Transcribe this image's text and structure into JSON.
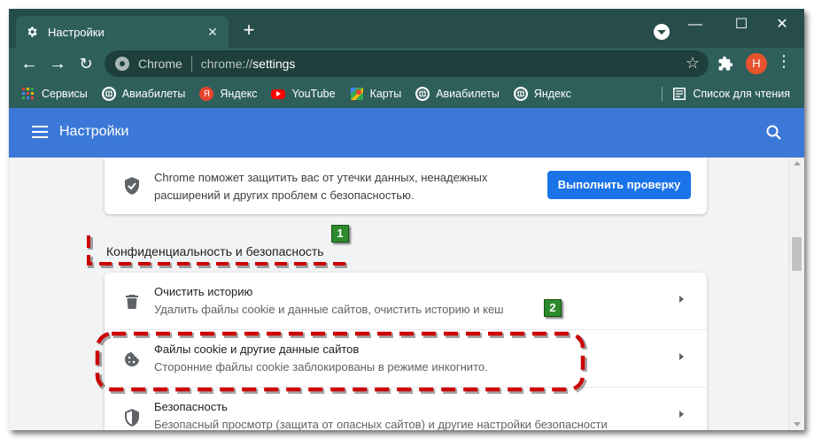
{
  "tab": {
    "title": "Настройки",
    "close": "✕",
    "new": "+"
  },
  "window_controls": {
    "minimize": "—",
    "maximize": "☐",
    "close": "✕"
  },
  "omnibox": {
    "site": "Chrome",
    "url_prefix": "chrome://",
    "url_path": "settings"
  },
  "profile": {
    "initial": "Н",
    "color": "#e8532d"
  },
  "bookmarks": {
    "items": [
      {
        "label": "Сервисы",
        "icon": "apps-grid-icon"
      },
      {
        "label": "Авиабилеты",
        "icon": "globe-icon"
      },
      {
        "label": "Яндекс",
        "icon": "yandex-icon"
      },
      {
        "label": "YouTube",
        "icon": "youtube-icon"
      },
      {
        "label": "Карты",
        "icon": "maps-icon"
      },
      {
        "label": "Авиабилеты",
        "icon": "globe-icon"
      },
      {
        "label": "Яндекс",
        "icon": "globe-icon"
      }
    ],
    "reading_list": "Список для чтения"
  },
  "settings": {
    "header_title": "Настройки",
    "safety": {
      "line1": "Chrome поможет защитить вас от утечки данных, ненадежных",
      "line2": "расширений и других проблем с безопасностью.",
      "button": "Выполнить проверку"
    },
    "privacy_section_title": "Конфиденциальность и безопасность",
    "rows": [
      {
        "title": "Очистить историю",
        "subtitle": "Удалить файлы cookie и данные сайтов, очистить историю и кеш",
        "icon": "trash-icon"
      },
      {
        "title": "Файлы cookie и другие данные сайтов",
        "subtitle": "Сторонние файлы cookie заблокированы в режиме инкогнито.",
        "icon": "cookie-icon"
      },
      {
        "title": "Безопасность",
        "subtitle": "Безопасный просмотр (защита от опасных сайтов) и другие настройки безопасности",
        "icon": "shield-icon"
      }
    ]
  },
  "annotations": {
    "badge1": "1",
    "badge2": "2",
    "color": "#cc0000"
  },
  "colors": {
    "titlebar": "#264d4a",
    "toolbar": "#2f5f5b",
    "header": "#3c78d8",
    "button": "#1a73e8"
  }
}
